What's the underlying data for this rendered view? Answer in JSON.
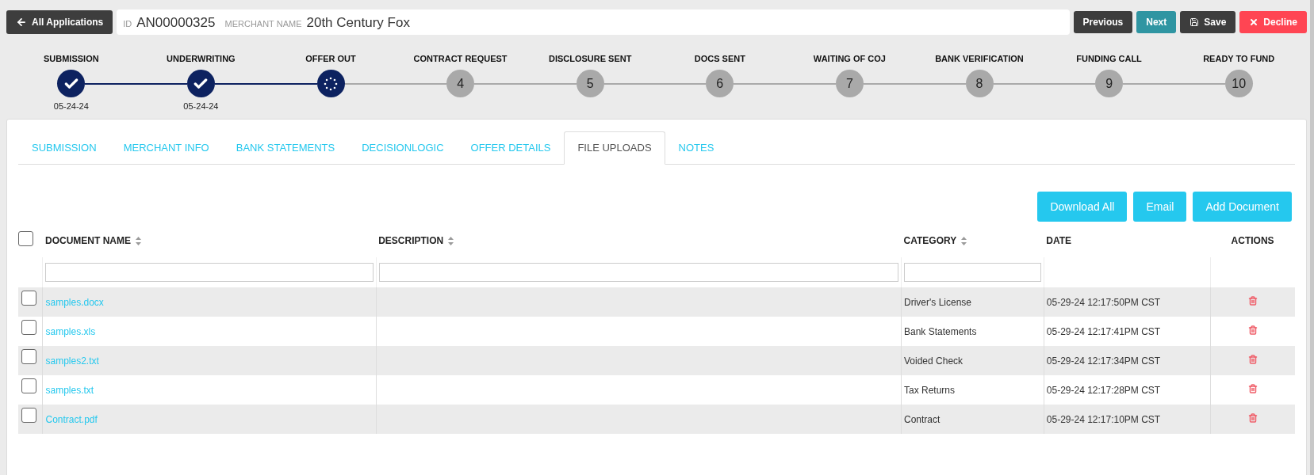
{
  "header": {
    "back_button": "All Applications",
    "id_label": "ID",
    "id_value": "AN00000325",
    "merchant_label": "MERCHANT NAME",
    "merchant_value": "20th Century Fox",
    "buttons": [
      {
        "kind": "previous",
        "label": "Previous"
      },
      {
        "kind": "next",
        "label": "Next"
      },
      {
        "kind": "save",
        "label": "Save"
      },
      {
        "kind": "decline",
        "label": "Decline"
      }
    ]
  },
  "steps": [
    {
      "label": "SUBMISSION",
      "kind": "done",
      "date": "05-24-24"
    },
    {
      "label": "UNDERWRITING",
      "kind": "done",
      "date": "05-24-24"
    },
    {
      "label": "OFFER OUT",
      "kind": "current"
    },
    {
      "label": "CONTRACT REQUEST",
      "kind": "pending",
      "number": "4"
    },
    {
      "label": "DISCLOSURE SENT",
      "kind": "pending",
      "number": "5"
    },
    {
      "label": "DOCS SENT",
      "kind": "pending",
      "number": "6"
    },
    {
      "label": "WAITING OF COJ",
      "kind": "pending",
      "number": "7"
    },
    {
      "label": "BANK VERIFICATION",
      "kind": "pending",
      "number": "8"
    },
    {
      "label": "FUNDING CALL",
      "kind": "pending",
      "number": "9"
    },
    {
      "label": "READY TO FUND",
      "kind": "pending",
      "number": "10"
    }
  ],
  "tabs": [
    {
      "label": "SUBMISSION",
      "selected": false
    },
    {
      "label": "MERCHANT INFO",
      "selected": false
    },
    {
      "label": "BANK STATEMENTS",
      "selected": false
    },
    {
      "label": "DECISIONLOGIC",
      "selected": false
    },
    {
      "label": "OFFER DETAILS",
      "selected": false
    },
    {
      "label": "FILE UPLOADS",
      "selected": true
    },
    {
      "label": "NOTES",
      "selected": false
    }
  ],
  "actions": [
    "Download All",
    "Email",
    "Add Document"
  ],
  "table": {
    "select_all_checked": false,
    "columns": [
      {
        "label": "DOCUMENT NAME",
        "sortable": true,
        "filter": true
      },
      {
        "label": "DESCRIPTION",
        "sortable": true,
        "filter": true
      },
      {
        "label": "CATEGORY",
        "sortable": true,
        "filter": true
      },
      {
        "label": "DATE",
        "sortable": false,
        "filter": false
      },
      {
        "label": "ACTIONS",
        "sortable": false,
        "filter": false
      }
    ],
    "rows": [
      {
        "checked": false,
        "name": "samples.docx",
        "category": "Driver's License",
        "date": "05-29-24 12:17:50PM CST"
      },
      {
        "checked": false,
        "name": "samples.xls",
        "category": "Bank Statements",
        "date": "05-29-24 12:17:41PM CST"
      },
      {
        "checked": false,
        "name": "samples2.txt",
        "category": "Voided Check",
        "date": "05-29-24 12:17:34PM CST"
      },
      {
        "checked": false,
        "name": "samples.txt",
        "category": "Tax Returns",
        "date": "05-29-24 12:17:28PM CST"
      },
      {
        "checked": false,
        "name": "Contract.pdf",
        "category": "Contract",
        "date": "05-29-24 12:17:10PM CST"
      }
    ]
  }
}
